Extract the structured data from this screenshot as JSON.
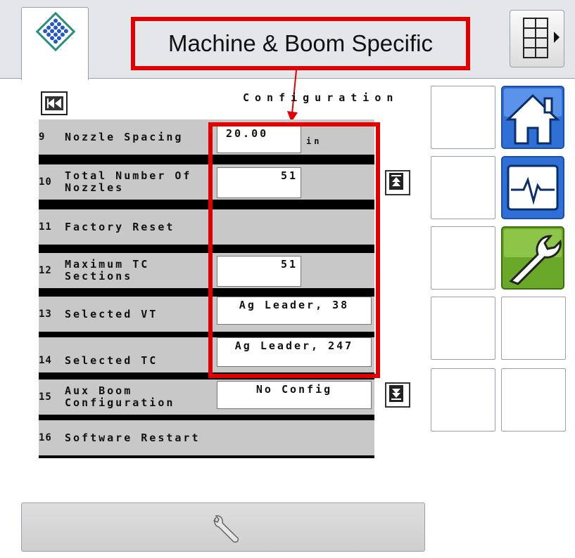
{
  "header": {
    "title": "Machine & Boom Specific"
  },
  "page": {
    "heading": "Configuration"
  },
  "settings": [
    {
      "num": "9",
      "label": "Nozzle Spacing",
      "value": "20.00",
      "unit": "in"
    },
    {
      "num": "10",
      "label": "Total Number Of Nozzles",
      "value": "51"
    },
    {
      "num": "11",
      "label": "Factory Reset"
    },
    {
      "num": "12",
      "label": "Maximum TC Sections",
      "value": "51"
    },
    {
      "num": "13",
      "label": "Selected VT",
      "value": "Ag Leader, 38"
    },
    {
      "num": "14",
      "label": "Selected TC",
      "value": "Ag Leader, 247"
    },
    {
      "num": "15",
      "label": "Aux Boom Configuration",
      "value": "No Config"
    },
    {
      "num": "16",
      "label": "Software Restart"
    }
  ],
  "icons": {
    "logo": "diamond-logo-icon",
    "grid": "grid-menu-icon",
    "back": "skip-back-icon",
    "page_top": "page-top-icon",
    "page_bottom": "page-bottom-icon",
    "home": "home-icon",
    "diagnostics": "heartbeat-icon",
    "tools": "wrench-icon",
    "bottom": "wrench-outline-icon"
  },
  "colors": {
    "highlight": "#e00000",
    "home_blue": "#2f6fd6",
    "tools_green": "#6aa82a"
  }
}
